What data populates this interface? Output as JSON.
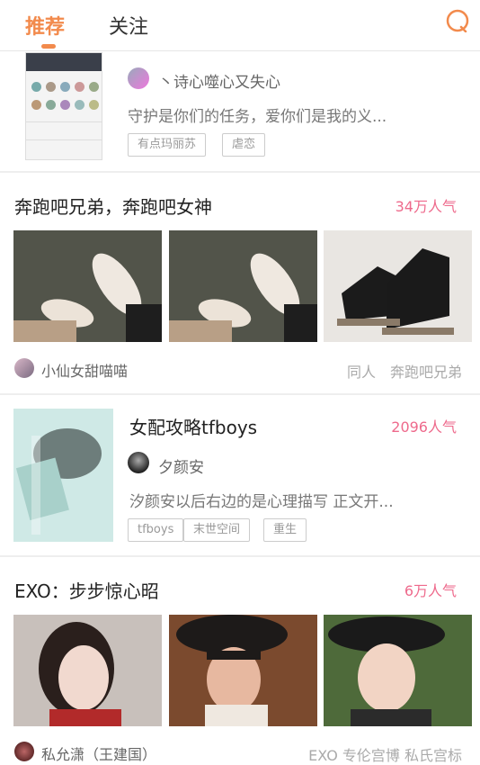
{
  "top_tabs": {
    "recommend": "推荐",
    "follow": "关注"
  },
  "items": [
    {
      "author": "丶诗心噬心又失心",
      "desc": "守护是你们的任务，爱你们是我的义...",
      "tags": [
        "有点玛丽苏",
        "虐恋"
      ]
    },
    {
      "title": "奔跑吧兄弟，奔跑吧女神",
      "popularity": "34万人气",
      "author": "小仙女甜喵喵",
      "meta": "同人　奔跑吧兄弟"
    },
    {
      "title": "女配攻略tfboys",
      "popularity": "2096人气",
      "author": "夕颜安",
      "desc": "汐颜安以后右边的是心理描写 正文开...",
      "tags": [
        "tfboys",
        "末世空间",
        "重生"
      ]
    },
    {
      "title": "EXO：步步惊心昭",
      "popularity": "6万人气",
      "author": "私允潇（王建国）",
      "meta": "EXO 专伦宫博 私氏宫标"
    }
  ],
  "colors": {
    "accent": "#f28a4c",
    "popularity": "#ee6a8c"
  }
}
